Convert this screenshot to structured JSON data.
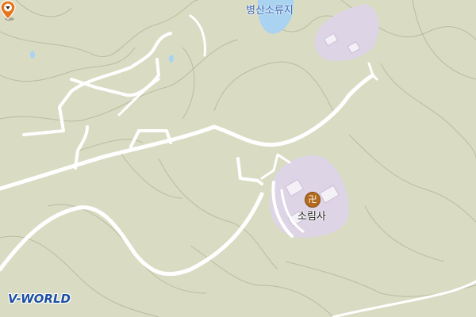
{
  "map": {
    "labels": {
      "reservoir": "병산소류지",
      "temple": "소림사"
    },
    "icons": {
      "temple_symbol": "卍",
      "marker": "location-pin-icon"
    },
    "logo": "V-WORLD",
    "colors": {
      "terrain": "#d9dcc3",
      "contour": "#b9bc9f",
      "road": "#ffffff",
      "water": "#a9d3f0",
      "building_area": "#ddd4e6",
      "marker": "#e8741c",
      "logo": "#1c4fa0"
    }
  }
}
